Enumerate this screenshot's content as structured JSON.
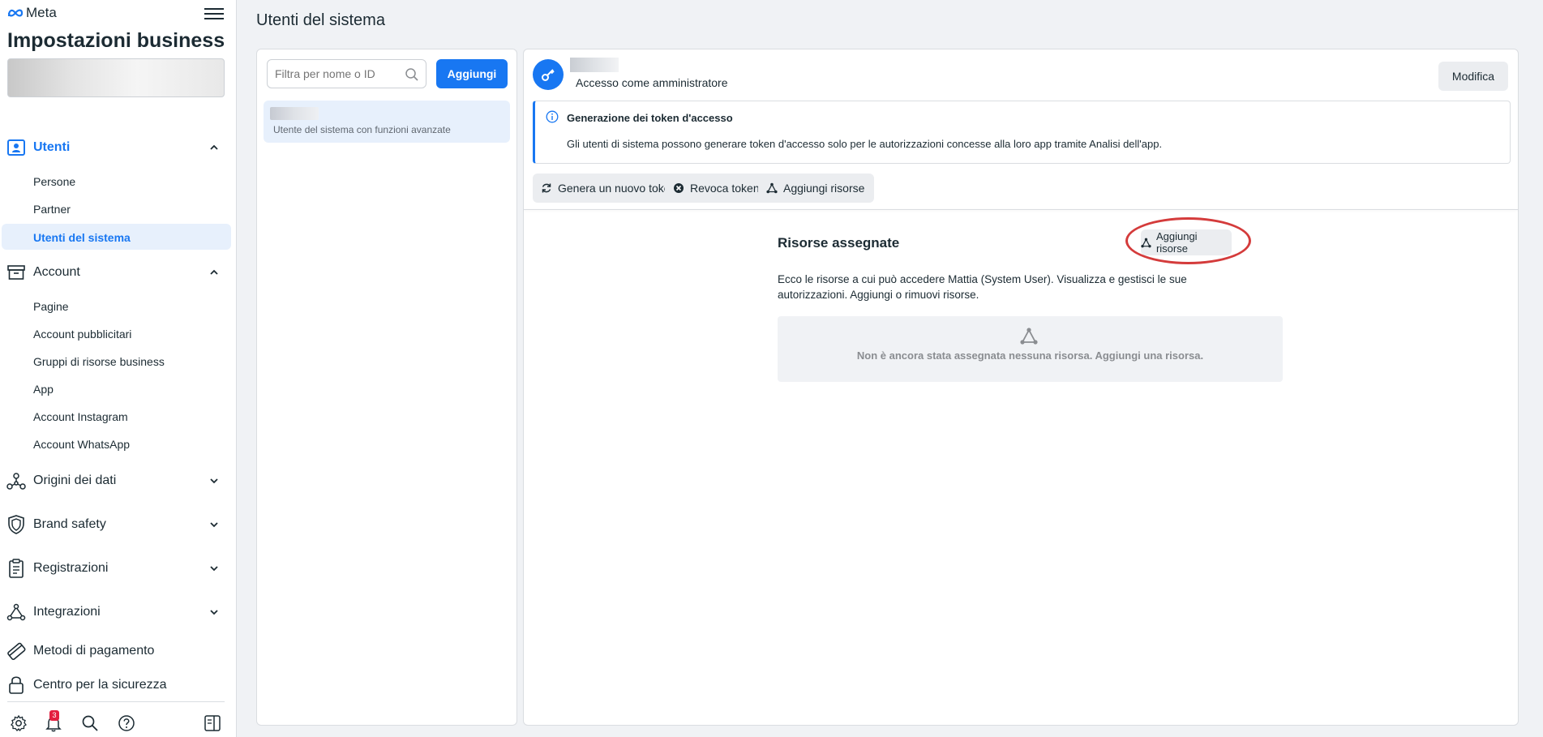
{
  "sidebar": {
    "logo_text": "Meta",
    "title": "Impostazioni business",
    "sections": {
      "users": {
        "label": "Utenti",
        "items": [
          "Persone",
          "Partner",
          "Utenti del sistema"
        ]
      },
      "account": {
        "label": "Account",
        "items": [
          "Pagine",
          "Account pubblicitari",
          "Gruppi di risorse business",
          "App",
          "Account Instagram",
          "Account WhatsApp"
        ]
      },
      "data_sources": {
        "label": "Origini dei dati"
      },
      "brand_safety": {
        "label": "Brand safety"
      },
      "registrations": {
        "label": "Registrazioni"
      },
      "integrations": {
        "label": "Integrazioni"
      },
      "payments": {
        "label": "Metodi di pagamento"
      },
      "security": {
        "label": "Centro per la sicurezza"
      }
    },
    "notification_count": "3"
  },
  "main": {
    "title": "Utenti del sistema"
  },
  "list_panel": {
    "search_placeholder": "Filtra per nome o ID",
    "add_label": "Aggiungi",
    "item_subtitle": "Utente del sistema con funzioni avanzate"
  },
  "detail": {
    "role": "Accesso come amministratore",
    "edit_label": "Modifica",
    "info_title": "Generazione dei token d'accesso",
    "info_text": "Gli utenti di sistema possono generare token d'accesso solo per le autorizzazioni concesse alla loro app tramite Analisi dell'app.",
    "actions": {
      "generate": "Genera un nuovo token",
      "revoke": "Revoca token",
      "add_assets": "Aggiungi risorse"
    },
    "assets": {
      "title": "Risorse assegnate",
      "add_label": "Aggiungi risorse",
      "description": "Ecco le risorse a cui può accedere Mattia (System User). Visualizza e gestisci le sue autorizzazioni. Aggiungi o rimuovi risorse.",
      "empty_text": "Non è ancora stata assegnata nessuna risorsa. Aggiungi una risorsa."
    }
  },
  "colors": {
    "accent": "#1877f2",
    "annotation": "#d43b3b"
  }
}
